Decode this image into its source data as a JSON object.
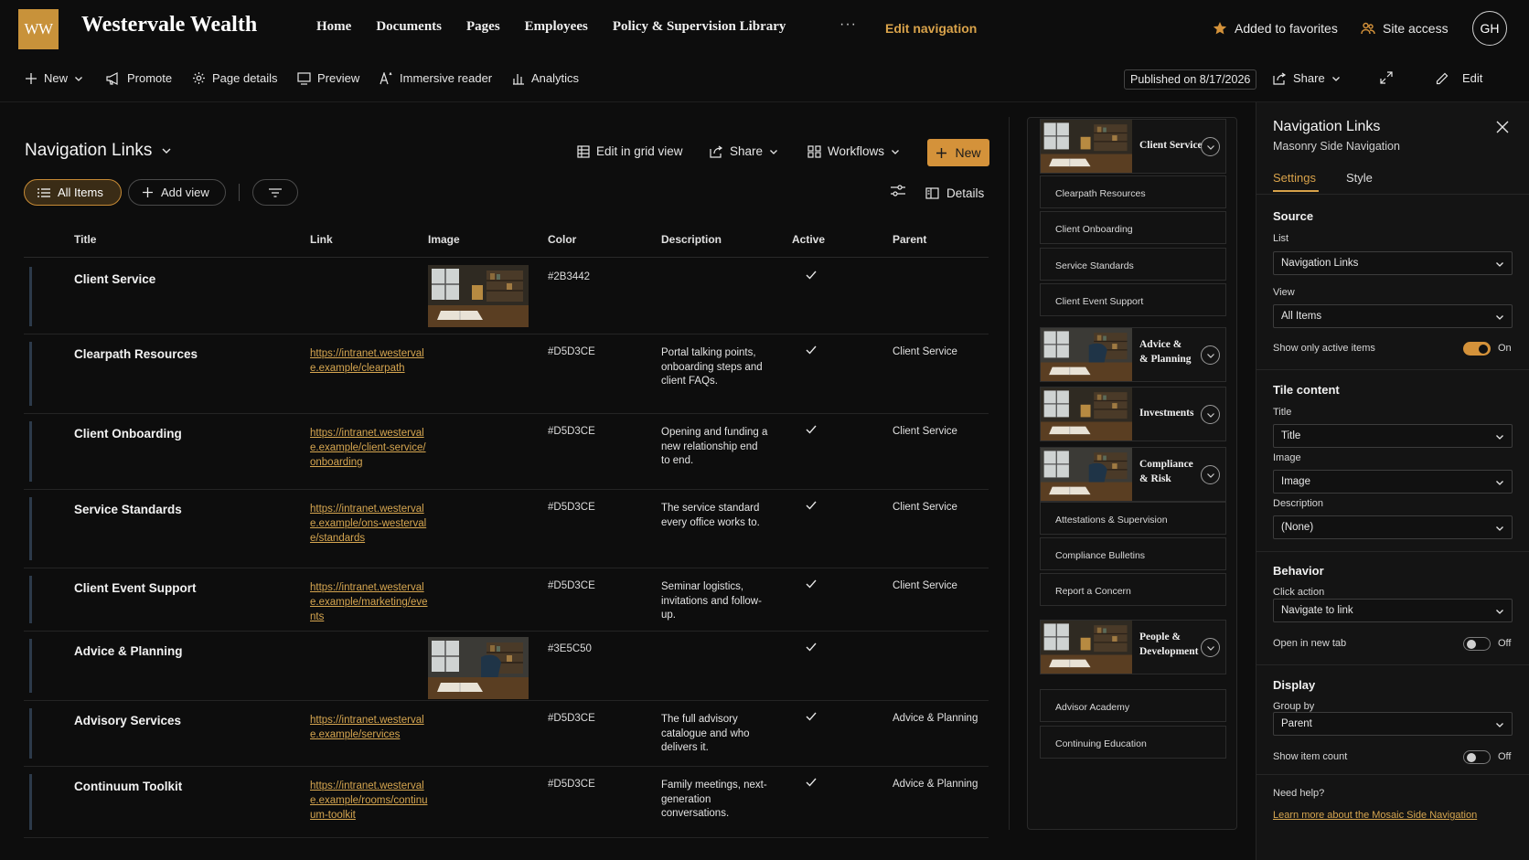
{
  "site": {
    "logo_text": "WW",
    "title": "Westervale Wealth",
    "nav": [
      "Home",
      "Documents",
      "Pages",
      "Employees",
      "Policy & Supervision Library"
    ],
    "nav_more": "···",
    "edit_navigation": "Edit navigation",
    "favorites": "Added to favorites",
    "site_access": "Site access",
    "avatar": "GH"
  },
  "command_bar": {
    "new": "New",
    "promote": "Promote",
    "page_details": "Page details",
    "preview": "Preview",
    "immersive_reader": "Immersive reader",
    "analytics": "Analytics",
    "published": "Published on 8/17/2026",
    "share": "Share",
    "edit": "Edit"
  },
  "list": {
    "title": "Navigation Links",
    "edit_grid": "Edit in grid view",
    "share": "Share",
    "workflows": "Workflows",
    "new": "New",
    "all_items": "All Items",
    "add_view": "Add view",
    "details": "Details",
    "columns": [
      "Title",
      "Link",
      "Image",
      "Color",
      "Description",
      "Active",
      "Parent"
    ],
    "rows": [
      {
        "title": "Client Service",
        "link": "",
        "image": true,
        "color": "#2B3442",
        "description": "",
        "active": true,
        "parent": ""
      },
      {
        "title": "Clearpath Resources",
        "link": "https://intranet.westervale.example/clearpath",
        "image": false,
        "color": "#D5D3CE",
        "description": "Portal talking points, onboarding steps and client FAQs.",
        "active": true,
        "parent": "Client Service"
      },
      {
        "title": "Client Onboarding",
        "link": "https://intranet.westervale.example/client-service/onboarding",
        "image": false,
        "color": "#D5D3CE",
        "description": "Opening and funding a new relationship end to end.",
        "active": true,
        "parent": "Client Service"
      },
      {
        "title": "Service Standards",
        "link": "https://intranet.westervale.example/ons-westervale/standards",
        "image": false,
        "color": "#D5D3CE",
        "description": "The service standard every office works to.",
        "active": true,
        "parent": "Client Service"
      },
      {
        "title": "Client Event Support",
        "link": "https://intranet.westervale.example/marketing/events",
        "image": false,
        "color": "#D5D3CE",
        "description": "Seminar logistics, invitations and follow-up.",
        "active": true,
        "parent": "Client Service"
      },
      {
        "title": "Advice & Planning",
        "link": "",
        "image": true,
        "color": "#3E5C50",
        "description": "",
        "active": true,
        "parent": ""
      },
      {
        "title": "Advisory Services",
        "link": "https://intranet.westervale.example/services",
        "image": false,
        "color": "#D5D3CE",
        "description": "The full advisory catalogue and who delivers it.",
        "active": true,
        "parent": "Advice & Planning"
      },
      {
        "title": "Continuum Toolkit",
        "link": "https://intranet.westervale.example/rooms/continuum-toolkit",
        "image": false,
        "color": "#D5D3CE",
        "description": "Family meetings, next-generation conversations.",
        "active": true,
        "parent": "Advice & Planning"
      }
    ]
  },
  "preview": {
    "tiles": [
      {
        "title": "Client Service",
        "children": [
          "Clearpath Resources",
          "Client Onboarding",
          "Service Standards",
          "Client Event Support"
        ]
      },
      {
        "title": "Advice & & Planning",
        "children": []
      },
      {
        "title": "Investments",
        "children": []
      },
      {
        "title": "Compliance & Risk",
        "children": [
          "Attestations & Supervision",
          "Compliance Bulletins",
          "Report a Concern"
        ]
      },
      {
        "title": "People & Development",
        "children": [
          "Advisor Academy",
          "Continuing Education"
        ]
      }
    ]
  },
  "panel": {
    "title": "Navigation Links",
    "subtitle": "Masonry Side Navigation",
    "tabs": [
      "Settings",
      "Style"
    ],
    "source": {
      "heading": "Source",
      "list_label": "List",
      "list_value": "Navigation Links",
      "view_label": "View",
      "view_value": "All Items",
      "active_only_label": "Show only active items",
      "active_only_value": "On"
    },
    "tile_content": {
      "heading": "Tile content",
      "title_label": "Title",
      "title_value": "Title",
      "image_label": "Image",
      "image_value": "Image",
      "desc_label": "Description",
      "desc_value": "(None)"
    },
    "behavior": {
      "heading": "Behavior",
      "click_label": "Click action",
      "click_value": "Navigate to link",
      "new_tab_label": "Open in new tab",
      "new_tab_value": "Off"
    },
    "display": {
      "heading": "Display",
      "group_label": "Group by",
      "group_value": "Parent",
      "count_label": "Show item count",
      "count_value": "Off"
    },
    "help_label": "Need help?",
    "help_link": "Learn more about the Mosaic Side Navigation"
  },
  "colors": {
    "accent": "#D4923A",
    "link": "#D6A650",
    "background": "#0D0D0D"
  }
}
